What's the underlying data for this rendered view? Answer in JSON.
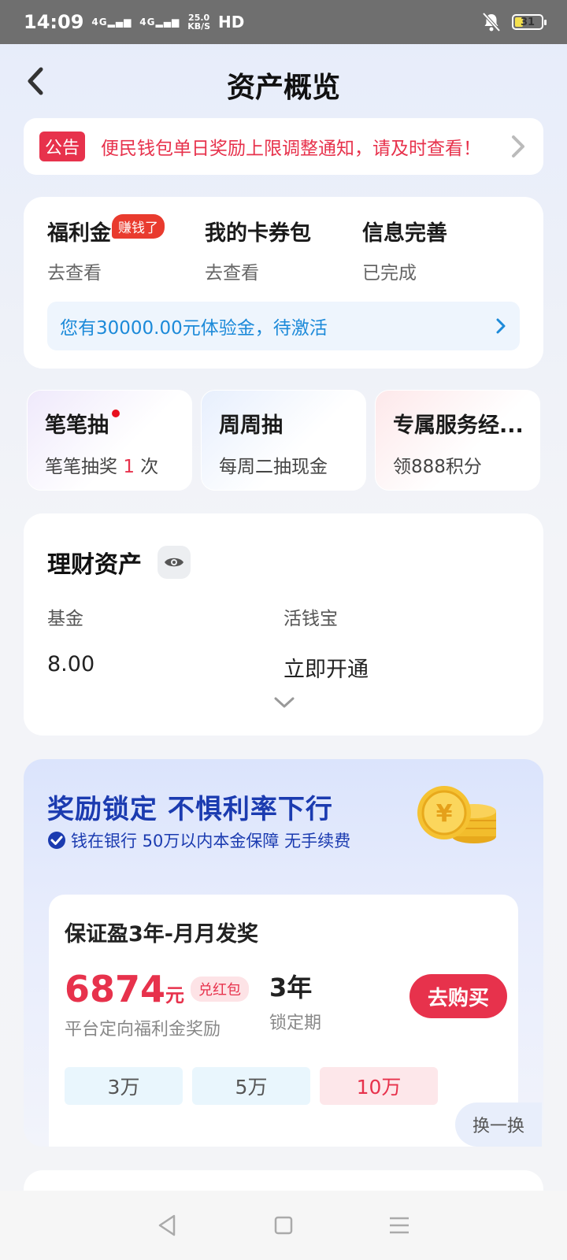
{
  "status_bar": {
    "time": "14:09",
    "signal1": "4G",
    "signal2": "4G",
    "speed_value": "25.0",
    "speed_unit": "KB/S",
    "hd": "HD",
    "battery": "31",
    "battery_level": 0.31,
    "mute_icon": "bell-off-icon"
  },
  "header": {
    "title": "资产概览",
    "back_icon": "chevron-left-icon"
  },
  "notice": {
    "tag": "公告",
    "text": "便民钱包单日奖励上限调整通知，请及时查看！"
  },
  "welfare": {
    "items": [
      {
        "title": "福利金",
        "badge": "赚钱了",
        "sub": "去查看"
      },
      {
        "title": "我的卡券包",
        "sub": "去查看"
      },
      {
        "title": "信息完善",
        "sub": "已完成"
      }
    ],
    "trial_text": "您有30000.00元体验金，待激活"
  },
  "mini_cards": [
    {
      "title": "笔笔抽",
      "sub_prefix": "笔笔抽奖 ",
      "sub_count": "1",
      "sub_suffix": " 次"
    },
    {
      "title": "周周抽",
      "sub": "每周二抽现金"
    },
    {
      "title": "专属服务经...",
      "sub": "领888积分"
    }
  ],
  "assets": {
    "title": "理财资产",
    "columns": [
      {
        "label": "基金",
        "value": "8.00"
      },
      {
        "label": "活钱宝",
        "value": "立即开通"
      }
    ]
  },
  "promo": {
    "title": "奖励锁定 不惧利率下行",
    "subtitle": "钱在银行 50万以内本金保障 无手续费",
    "product": {
      "name": "保证盈3年-月月发奖",
      "amount": "6874",
      "amount_unit": "元",
      "redpack": "兑红包",
      "amount_label": "平台定向福利金奖励",
      "lock_value": "3年",
      "lock_label": "锁定期",
      "buy_label": "去购买",
      "amounts": [
        "3万",
        "5万",
        "10万"
      ],
      "selected_index": 2
    },
    "swap_label": "换一换"
  },
  "colors": {
    "accent_red": "#e7324c",
    "link_blue": "#1c8ad9",
    "promo_blue": "#1b3bb0"
  }
}
